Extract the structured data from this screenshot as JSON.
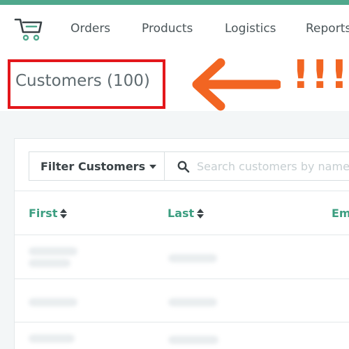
{
  "colors": {
    "accent": "#4fa88c",
    "highlight": "#e3171b",
    "arrow": "#f26522",
    "header_link": "#3c9e80"
  },
  "nav": {
    "logo_icon": "shopping-cart-icon",
    "items": [
      "Orders",
      "Products",
      "Logistics",
      "Reports"
    ]
  },
  "page": {
    "title": "Customers (100)"
  },
  "annotation": {
    "exclamation": "!!!"
  },
  "filter": {
    "button_label": "Filter Customers",
    "search_placeholder": "Search customers by name"
  },
  "table": {
    "columns": [
      "First",
      "Last",
      "Em"
    ],
    "row_count_visible": 3
  }
}
